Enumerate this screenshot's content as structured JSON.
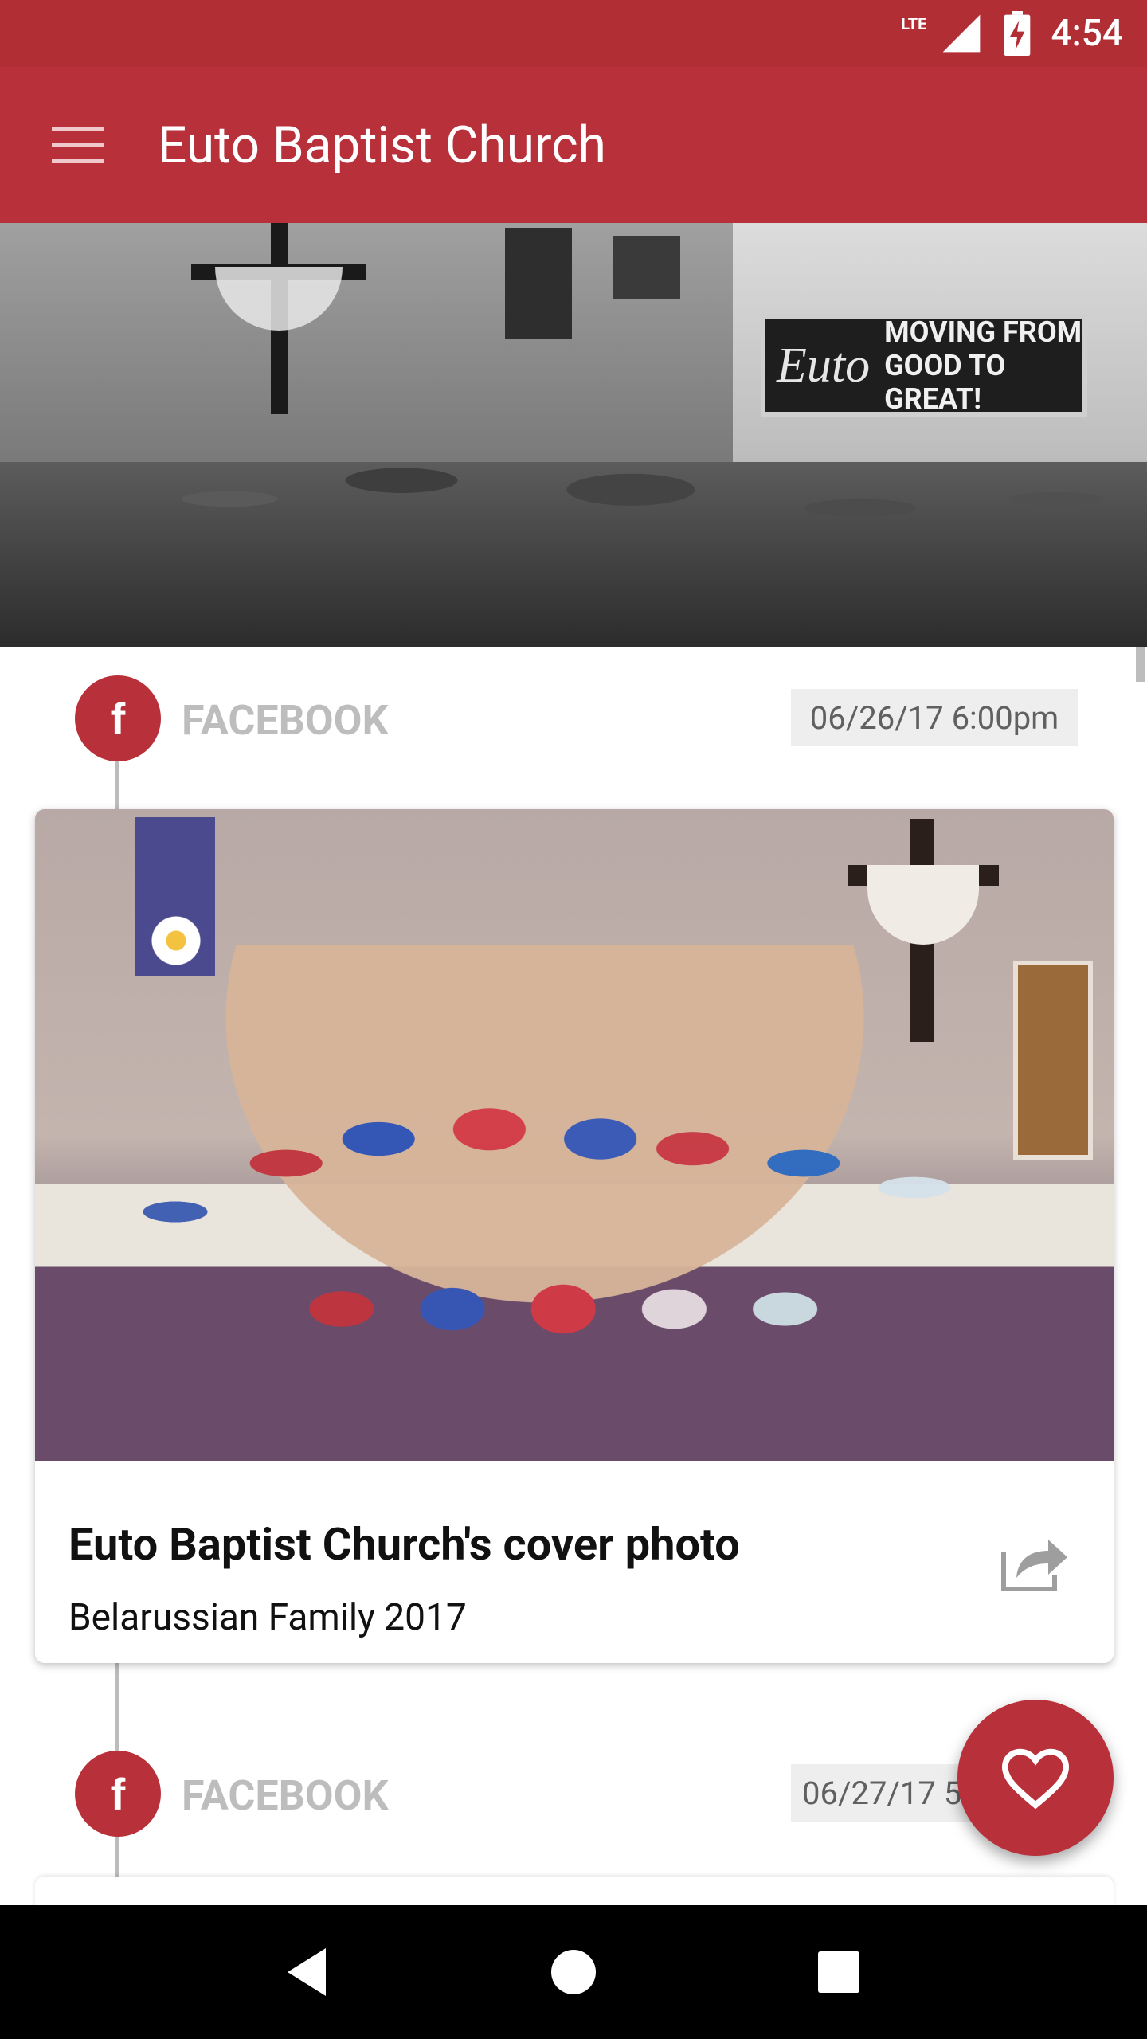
{
  "status_bar": {
    "network": "LTE",
    "time": "4:54",
    "icons": [
      "lte-signal-icon",
      "battery-charging-icon"
    ]
  },
  "app_bar": {
    "title": "Euto Baptist Church",
    "menu_icon": "hamburger-menu-icon"
  },
  "hero": {
    "sign_logo": "Euto",
    "sign_text": "MOVING FROM\nGOOD TO GREAT!"
  },
  "posts": [
    {
      "source": "FACEBOOK",
      "source_icon": "facebook-icon",
      "icon_letter": "f",
      "date": "06/26/17 6:00pm",
      "title": "Euto Baptist Church's cover photo",
      "subtitle": "Belarussian Family 2017",
      "share_icon": "share-icon"
    },
    {
      "source": "FACEBOOK",
      "source_icon": "facebook-icon",
      "icon_letter": "f",
      "date": "06/27/17 5"
    }
  ],
  "fab": {
    "icon": "heart-icon"
  },
  "nav_bar": {
    "icons": [
      "back-icon",
      "home-icon",
      "recents-icon"
    ]
  },
  "colors": {
    "primary": "#b8303a",
    "status_bar": "#b02e34",
    "source_label": "#bdbdbd",
    "date_chip_bg": "#eeeeee"
  }
}
